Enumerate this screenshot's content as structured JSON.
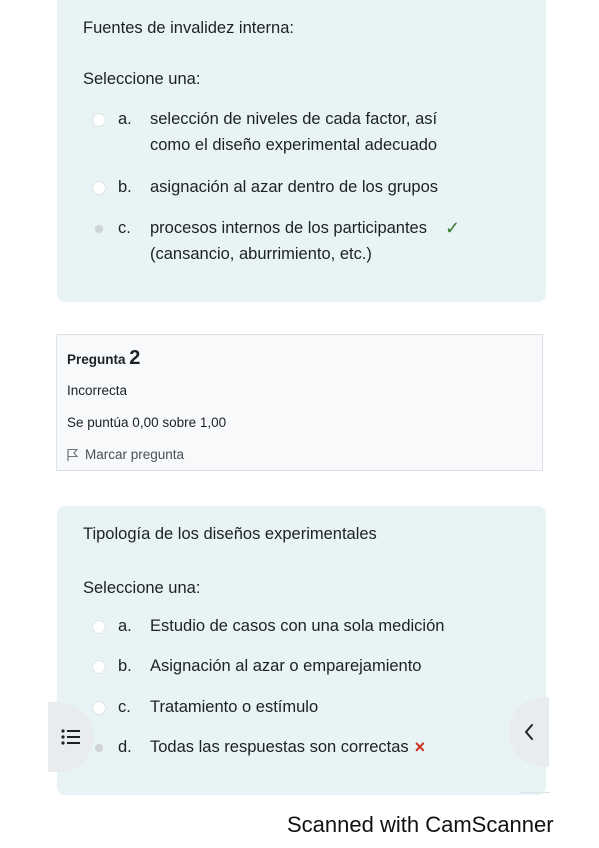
{
  "question1": {
    "text": "Fuentes de invalidez interna:",
    "prompt": "Seleccione una:",
    "answers": [
      {
        "letter": "a.",
        "line1": "selección de niveles de cada factor, así",
        "line2": "como el diseño experimental adecuado",
        "selected": false
      },
      {
        "letter": "b.",
        "line1": "asignación al azar dentro de los grupos",
        "selected": false
      },
      {
        "letter": "c.",
        "line1": "procesos internos de los participantes",
        "line2": "(cansancio, aburrimiento, etc.)",
        "selected": true,
        "mark": "✓"
      }
    ]
  },
  "question2_info": {
    "label": "Pregunta",
    "number": "2",
    "state": "Incorrecta",
    "grade": "Se puntúa 0,00 sobre 1,00",
    "flag_label": "Marcar pregunta"
  },
  "question2": {
    "text": "Tipología de los diseños experimentales",
    "prompt": "Seleccione una:",
    "answers": [
      {
        "letter": "a.",
        "line1": "Estudio de casos con una sola medición",
        "selected": false
      },
      {
        "letter": "b.",
        "line1": "Asignación al azar o emparejamiento",
        "selected": false
      },
      {
        "letter": "c.",
        "line1": "Tratamiento o estímulo",
        "selected": false
      },
      {
        "letter": "d.",
        "line1": "Todas las respuestas son correctas",
        "selected": true,
        "mark": "×"
      }
    ]
  },
  "drawer_icon": "list-icon",
  "back_icon": "chevron-left-icon",
  "watermark": "Scanned with CamScanner",
  "colors": {
    "panel": "#e7f3f5",
    "correct": "#357a32",
    "incorrect": "#ca3120"
  }
}
